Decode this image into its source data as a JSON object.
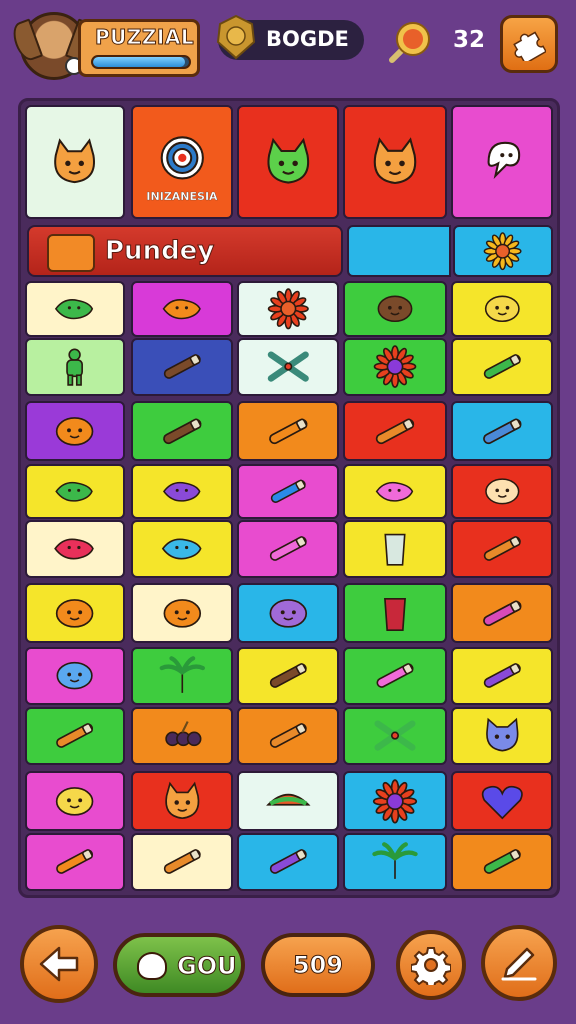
{
  "header": {
    "title": "PUZZIAL",
    "xp_progress": 0.96,
    "rank_label": "BOGDE",
    "coins": "32"
  },
  "board": {
    "banner_text": "Pundey",
    "tiles": [
      {
        "color": "#e6f7e6",
        "icon": "cat-face-icon"
      },
      {
        "color": "#f25a1c",
        "icon": "target-logo-icon",
        "caption": "INIZANESIA"
      },
      {
        "color": "#e8301e",
        "icon": "green-cat-icon"
      },
      {
        "color": "#e8301e",
        "icon": "orange-cat-icon"
      },
      {
        "color": "#e84ccf",
        "icon": "ghost-icon"
      },
      {
        "color": "#29b6e8",
        "icon": "sunflower-icon"
      },
      {
        "color": "#fff4c9",
        "icon": "green-fish-icon"
      },
      {
        "color": "#d83ad8",
        "icon": "orange-fish-icon"
      },
      {
        "color": "#e8f8f0",
        "icon": "red-sun-icon"
      },
      {
        "color": "#3ecc3e",
        "icon": "brown-blob-icon"
      },
      {
        "color": "#f5e52a",
        "icon": "yellow-face-icon"
      },
      {
        "color": "#b8f0a0",
        "icon": "green-figure-icon"
      },
      {
        "color": "#3a4fb8",
        "icon": "brown-stick-icon"
      },
      {
        "color": "#e8f8f0",
        "icon": "green-crossed-icon"
      },
      {
        "color": "#3ecc3e",
        "icon": "red-flower-icon"
      },
      {
        "color": "#f5e52a",
        "icon": "green-stick-icon"
      },
      {
        "color": "#9a3ad8",
        "icon": "orange-blob-icon"
      },
      {
        "color": "#3ecc3e",
        "icon": "brown-log-icon"
      },
      {
        "color": "#f28a1c",
        "icon": "orange-stick-icon"
      },
      {
        "color": "#e8301e",
        "icon": "gun-icon"
      },
      {
        "color": "#29b6e8",
        "icon": "crayon-icon"
      },
      {
        "color": "#f5e52a",
        "icon": "green-fish-icon"
      },
      {
        "color": "#f5e52a",
        "icon": "purple-lizard-icon"
      },
      {
        "color": "#e84ccf",
        "icon": "tube-icon"
      },
      {
        "color": "#f5e52a",
        "icon": "pink-fish-icon"
      },
      {
        "color": "#e8301e",
        "icon": "peach-face-icon"
      },
      {
        "color": "#fff4c9",
        "icon": "red-candy-icon"
      },
      {
        "color": "#f5e52a",
        "icon": "blue-bone-icon"
      },
      {
        "color": "#e84ccf",
        "icon": "pink-stick-icon"
      },
      {
        "color": "#f5e52a",
        "icon": "glove-icon"
      },
      {
        "color": "#e8301e",
        "icon": "pen-icon"
      },
      {
        "color": "#f5e52a",
        "icon": "orange-fruit-icon"
      },
      {
        "color": "#fff4c9",
        "icon": "orange-bird-icon"
      },
      {
        "color": "#29b6e8",
        "icon": "purple-creature-icon"
      },
      {
        "color": "#3ecc3e",
        "icon": "red-pot-icon"
      },
      {
        "color": "#f28a1c",
        "icon": "pink-crayon-icon"
      },
      {
        "color": "#e84ccf",
        "icon": "blue-cloud-icon"
      },
      {
        "color": "#3ecc3e",
        "icon": "palm-icon"
      },
      {
        "color": "#f5e52a",
        "icon": "brown-stick-icon"
      },
      {
        "color": "#3ecc3e",
        "icon": "pink-tool-icon"
      },
      {
        "color": "#f5e52a",
        "icon": "purple-stick-icon"
      },
      {
        "color": "#3ecc3e",
        "icon": "knife-icon"
      },
      {
        "color": "#f28a1c",
        "icon": "grapes-icon"
      },
      {
        "color": "#f28a1c",
        "icon": "hammer-icon"
      },
      {
        "color": "#3ecc3e",
        "icon": "scissors-icon"
      },
      {
        "color": "#f5e52a",
        "icon": "blue-cat-icon"
      },
      {
        "color": "#e84ccf",
        "icon": "yellow-chick-icon"
      },
      {
        "color": "#e8301e",
        "icon": "orange-cat-icon"
      },
      {
        "color": "#e8f8f0",
        "icon": "taco-icon"
      },
      {
        "color": "#29b6e8",
        "icon": "red-flower-icon"
      },
      {
        "color": "#e8301e",
        "icon": "heart-icon"
      },
      {
        "color": "#e84ccf",
        "icon": "orange-stick-icon"
      },
      {
        "color": "#fff4c9",
        "icon": "wand-icon"
      },
      {
        "color": "#29b6e8",
        "icon": "purple-stick-icon"
      },
      {
        "color": "#29b6e8",
        "icon": "palm-icon"
      },
      {
        "color": "#f28a1c",
        "icon": "green-stick-icon"
      }
    ]
  },
  "footer": {
    "go_label": "GOU",
    "score_label": "509"
  }
}
